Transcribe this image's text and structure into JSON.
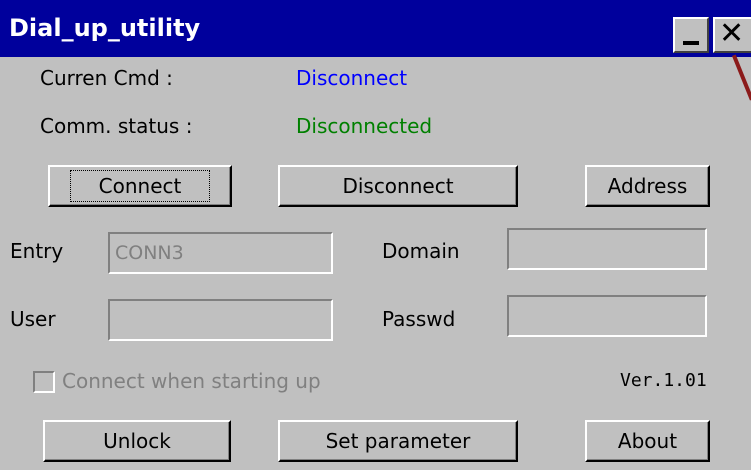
{
  "window": {
    "title": "Dial_up_utility",
    "minimize_glyph": "_",
    "close_glyph": "✕"
  },
  "status": {
    "current_cmd_label": "Curren Cmd :",
    "current_cmd_value": "Disconnect",
    "comm_status_label": "Comm. status :",
    "comm_status_value": "Disconnected"
  },
  "actions": {
    "connect": "Connect",
    "disconnect": "Disconnect",
    "address": "Address"
  },
  "form": {
    "entry_label": "Entry",
    "entry_value": "CONN3",
    "domain_label": "Domain",
    "domain_value": "",
    "user_label": "User",
    "user_value": "",
    "passwd_label": "Passwd",
    "passwd_value": ""
  },
  "options": {
    "startup_label": "Connect when starting up",
    "startup_checked": false,
    "version": "Ver.1.01"
  },
  "footer": {
    "unlock": "Unlock",
    "set_parameter": "Set parameter",
    "about": "About"
  },
  "colors": {
    "titlebar": "#00009c",
    "background": "#c0c0c0",
    "cmd_value": "#0000ff",
    "status_value": "#008000"
  }
}
